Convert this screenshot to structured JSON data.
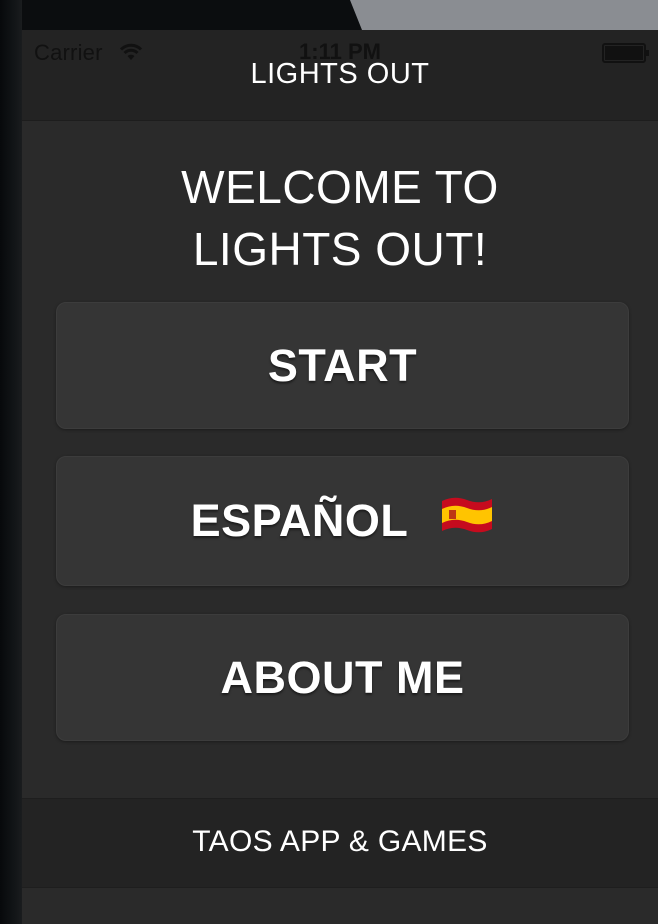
{
  "status_bar": {
    "carrier": "Carrier",
    "time": "1:11 PM",
    "wifi_icon": "wifi-icon",
    "battery_icon": "battery-icon"
  },
  "nav": {
    "title": "LIGHTS OUT"
  },
  "main": {
    "welcome_line1": "WELCOME TO",
    "welcome_line2": "LIGHTS OUT!",
    "buttons": [
      {
        "label": "START"
      },
      {
        "label": "ESPAÑOL",
        "icon": "spain-flag-icon"
      },
      {
        "label": "ABOUT ME"
      }
    ]
  },
  "footer": {
    "text": "TAOS APP & GAMES"
  },
  "colors": {
    "background": "#2a2a2a",
    "bar": "#232323",
    "button": "#353535",
    "text": "#ffffff"
  }
}
